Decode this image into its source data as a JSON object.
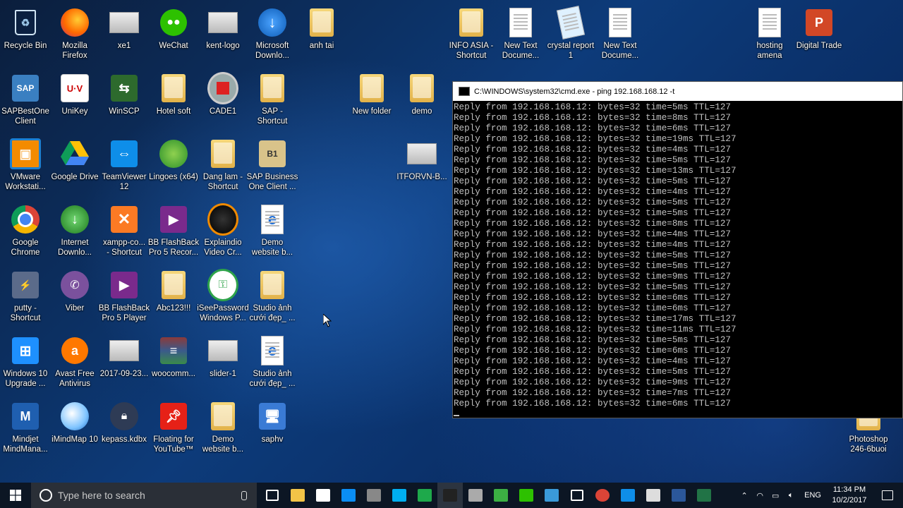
{
  "desktop": {
    "icons": [
      {
        "label": "Recycle Bin",
        "icon": "recycle-bin-icon"
      },
      {
        "label": "Mozilla\nFirefox",
        "icon": "firefox-icon"
      },
      {
        "label": "xe1",
        "icon": "image-thumbnail-icon"
      },
      {
        "label": "WeChat",
        "icon": "wechat-icon"
      },
      {
        "label": "kent-logo",
        "icon": "image-thumbnail-icon"
      },
      {
        "label": "Microsoft\nDownlo...",
        "icon": "download-arrow-icon"
      },
      {
        "label": "anh tai",
        "icon": "folder-icon"
      },
      {
        "label": "INFO ASIA -\nShortcut",
        "icon": "folder-icon"
      },
      {
        "label": "New Text\nDocume...",
        "icon": "text-document-icon"
      },
      {
        "label": "crystal report\n1",
        "icon": "notepad-icon"
      },
      {
        "label": "New Text\nDocume...",
        "icon": "text-document-icon"
      },
      {
        "label": "hosting\namena",
        "icon": "text-document-icon"
      },
      {
        "label": "Digital Trade",
        "icon": "powerpoint-icon"
      },
      {
        "label": "SAPBestOne\nClient",
        "icon": "sap-client-icon"
      },
      {
        "label": "UniKey",
        "icon": "unikey-icon"
      },
      {
        "label": "WinSCP",
        "icon": "winscp-icon"
      },
      {
        "label": "Hotel soft",
        "icon": "folder-icon"
      },
      {
        "label": "CADE1",
        "icon": "cade-icon"
      },
      {
        "label": "SAP -\nShortcut",
        "icon": "folder-icon"
      },
      {
        "label": "New folder",
        "icon": "folder-icon"
      },
      {
        "label": "demo",
        "icon": "folder-icon"
      },
      {
        "label": "VMware\nWorkstati...",
        "icon": "vmware-icon"
      },
      {
        "label": "Google Drive",
        "icon": "google-drive-icon"
      },
      {
        "label": "TeamViewer\n12",
        "icon": "teamviewer-icon"
      },
      {
        "label": "Lingoes (x64)",
        "icon": "lingoes-icon"
      },
      {
        "label": "Dang lam -\nShortcut",
        "icon": "folder-icon"
      },
      {
        "label": "SAP Business\nOne Client ...",
        "icon": "sap-business-one-icon"
      },
      {
        "label": "ITFORVN-B...",
        "icon": "image-thumbnail-icon"
      },
      {
        "label": "Google\nChrome",
        "icon": "chrome-icon"
      },
      {
        "label": "Internet\nDownlo...",
        "icon": "internet-download-manager-icon"
      },
      {
        "label": "xampp-co...\n- Shortcut",
        "icon": "xampp-icon"
      },
      {
        "label": "BB FlashBack\nPro 5 Recor...",
        "icon": "flashback-recorder-icon"
      },
      {
        "label": "Explaindio\nVideo Cr...",
        "icon": "explaindio-icon"
      },
      {
        "label": "Demo\nwebsite b...",
        "icon": "edge-icon"
      },
      {
        "label": "putty -\nShortcut",
        "icon": "putty-icon"
      },
      {
        "label": "Viber",
        "icon": "viber-icon"
      },
      {
        "label": "BB FlashBack\nPro 5 Player",
        "icon": "flashback-player-icon"
      },
      {
        "label": "Abc123!!!",
        "icon": "folder-icon"
      },
      {
        "label": "iSeePassword\nWindows P...",
        "icon": "iseepassword-icon"
      },
      {
        "label": "Studio ảnh\ncưới đẹp_ ...",
        "icon": "folder-icon"
      },
      {
        "label": "Windows 10\nUpgrade ...",
        "icon": "windows-icon"
      },
      {
        "label": "Avast Free\nAntivirus",
        "icon": "avast-icon"
      },
      {
        "label": "2017-09-23...",
        "icon": "image-thumbnail-icon"
      },
      {
        "label": "woocomm...",
        "icon": "winrar-icon"
      },
      {
        "label": "slider-1",
        "icon": "image-thumbnail-icon"
      },
      {
        "label": "Studio ảnh\ncưới đẹp_ ...",
        "icon": "edge-icon"
      },
      {
        "label": "Mindjet\nMindMana...",
        "icon": "mindjet-icon"
      },
      {
        "label": "iMindMap 10",
        "icon": "imindmap-icon"
      },
      {
        "label": "kepass.kdbx",
        "icon": "keepass-icon"
      },
      {
        "label": "Floating for\nYouTube™",
        "icon": "floating-youtube-icon"
      },
      {
        "label": "Demo\nwebsite b...",
        "icon": "folder-icon"
      },
      {
        "label": "saphv",
        "icon": "network-computer-icon"
      },
      {
        "label": "Photoshop\n246-6buoi",
        "icon": "folder-icon"
      }
    ]
  },
  "cmd": {
    "title": "C:\\WINDOWS\\system32\\cmd.exe - ping  192.168.168.12 -t",
    "lines": [
      "Reply from 192.168.168.12: bytes=32 time=5ms TTL=127",
      "Reply from 192.168.168.12: bytes=32 time=8ms TTL=127",
      "Reply from 192.168.168.12: bytes=32 time=6ms TTL=127",
      "Reply from 192.168.168.12: bytes=32 time=19ms TTL=127",
      "Reply from 192.168.168.12: bytes=32 time=4ms TTL=127",
      "Reply from 192.168.168.12: bytes=32 time=5ms TTL=127",
      "Reply from 192.168.168.12: bytes=32 time=13ms TTL=127",
      "Reply from 192.168.168.12: bytes=32 time=5ms TTL=127",
      "Reply from 192.168.168.12: bytes=32 time=4ms TTL=127",
      "Reply from 192.168.168.12: bytes=32 time=5ms TTL=127",
      "Reply from 192.168.168.12: bytes=32 time=5ms TTL=127",
      "Reply from 192.168.168.12: bytes=32 time=8ms TTL=127",
      "Reply from 192.168.168.12: bytes=32 time=4ms TTL=127",
      "Reply from 192.168.168.12: bytes=32 time=4ms TTL=127",
      "Reply from 192.168.168.12: bytes=32 time=5ms TTL=127",
      "Reply from 192.168.168.12: bytes=32 time=5ms TTL=127",
      "Reply from 192.168.168.12: bytes=32 time=9ms TTL=127",
      "Reply from 192.168.168.12: bytes=32 time=5ms TTL=127",
      "Reply from 192.168.168.12: bytes=32 time=6ms TTL=127",
      "Reply from 192.168.168.12: bytes=32 time=6ms TTL=127",
      "Reply from 192.168.168.12: bytes=32 time=17ms TTL=127",
      "Reply from 192.168.168.12: bytes=32 time=11ms TTL=127",
      "Reply from 192.168.168.12: bytes=32 time=5ms TTL=127",
      "Reply from 192.168.168.12: bytes=32 time=6ms TTL=127",
      "Reply from 192.168.168.12: bytes=32 time=4ms TTL=127",
      "Reply from 192.168.168.12: bytes=32 time=5ms TTL=127",
      "Reply from 192.168.168.12: bytes=32 time=9ms TTL=127",
      "Reply from 192.168.168.12: bytes=32 time=7ms TTL=127",
      "Reply from 192.168.168.12: bytes=32 time=6ms TTL=127"
    ]
  },
  "taskbar": {
    "search_placeholder": "Type here to search",
    "pinned": [
      "task-view-icon",
      "file-explorer-icon",
      "store-icon",
      "zalo-icon",
      "vpn-icon",
      "skype-icon",
      "stock-chart-icon",
      "cmd-icon",
      "tablet-icon",
      "green-diamond-icon",
      "wechat-icon",
      "monitor-icon",
      "settings-gear-icon",
      "chrome-icon",
      "teamviewer-icon",
      "photos-icon",
      "word-icon",
      "excel-icon"
    ],
    "tray": {
      "language": "ENG",
      "time": "11:34 PM",
      "date": "10/2/2017"
    }
  },
  "colors": {
    "taskbar_bg": "#0c1624",
    "cmd_text": "#c0c0c0",
    "accent": "#0078d7"
  }
}
